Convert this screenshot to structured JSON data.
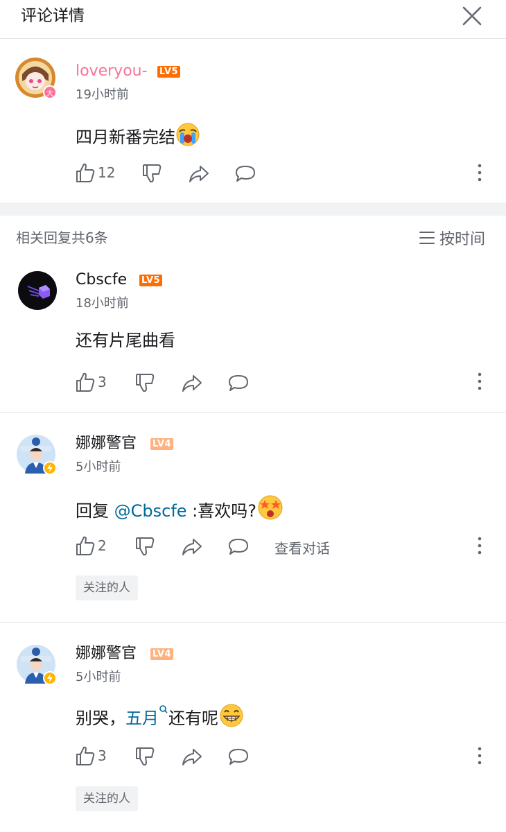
{
  "header": {
    "title": "评论详情"
  },
  "main_comment": {
    "username": "loveryou-",
    "level": "LV5",
    "avatar_badge": "大",
    "time": "19小时前",
    "content": "四月新番完结",
    "emoji": "crying-emoji",
    "likes": "12"
  },
  "replies_header": {
    "count_text": "相关回复共6条",
    "sort_label": "按时间"
  },
  "replies": [
    {
      "username": "Cbscfe",
      "level": "LV5",
      "time": "18小时前",
      "content": "还有片尾曲看",
      "likes": "3"
    },
    {
      "username": "娜娜警官",
      "level": "LV4",
      "time": "5小时前",
      "content_prefix": "回复 ",
      "mention": "@Cbscfe",
      "content_suffix": " :喜欢吗?",
      "emoji": "starry-eyes-emoji",
      "likes": "2",
      "view_conversation": "查看对话",
      "tag": "关注的人"
    },
    {
      "username": "娜娜警官",
      "level": "LV4",
      "time": "5小时前",
      "content_prefix": "别哭，",
      "link": "五月",
      "content_suffix": "还有呢",
      "emoji": "grin-emoji",
      "likes": "3",
      "tag": "关注的人"
    }
  ],
  "colors": {
    "pink_name": "#fb7299",
    "link": "#00699d",
    "lv5": "#ff6c00",
    "lv4": "#ffb27f",
    "gray": "#61666d"
  }
}
